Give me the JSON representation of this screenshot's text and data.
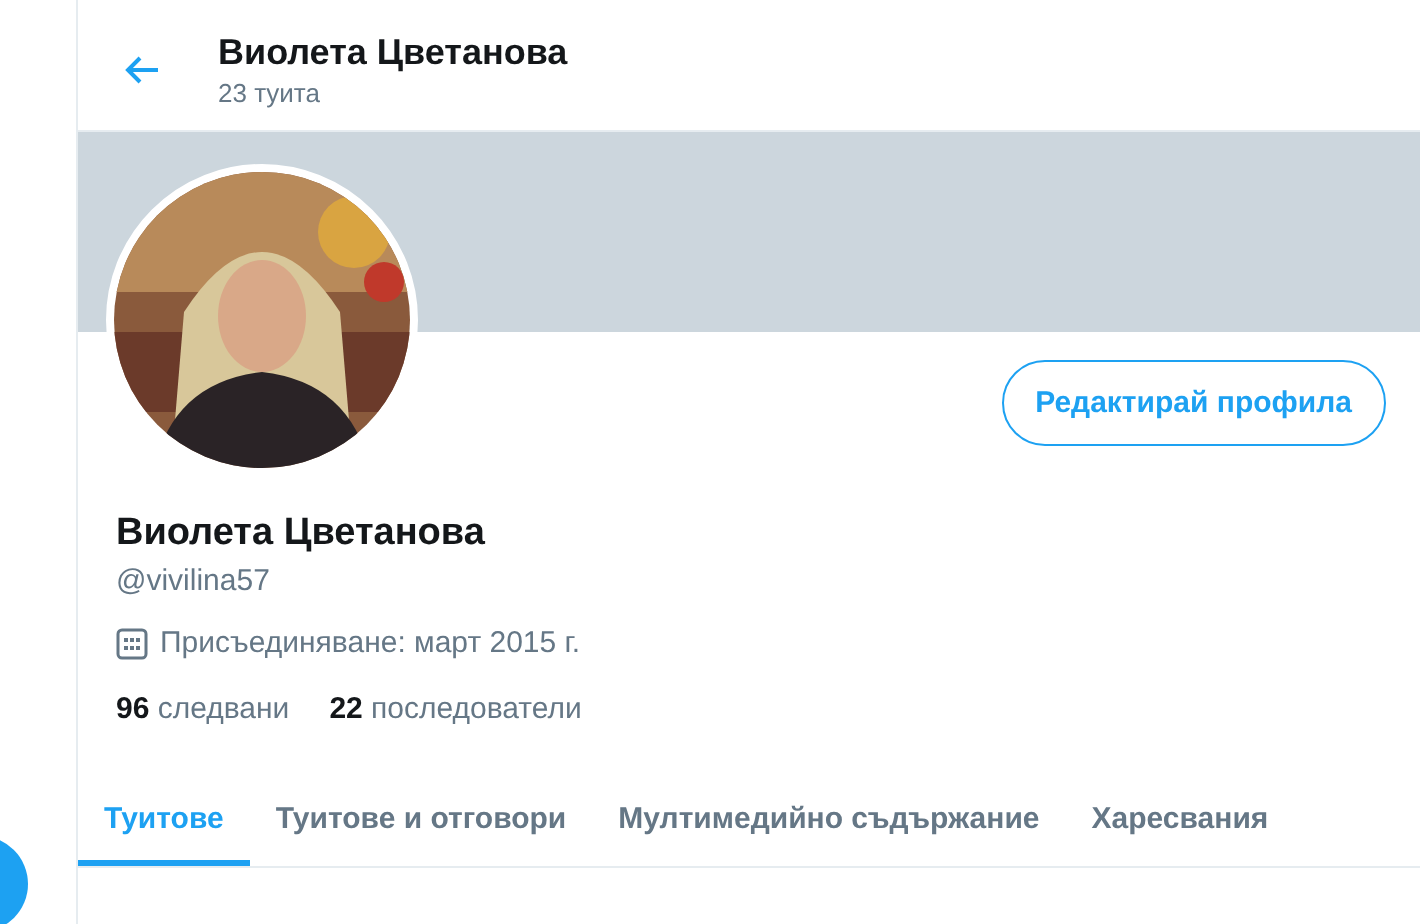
{
  "header": {
    "title": "Виолета Цветанова",
    "subtitle": "23 туита"
  },
  "profile": {
    "edit_button": "Редактирай профила",
    "name": "Виолета Цветанова",
    "handle": "@vivilina57",
    "joined": "Присъединяване: март 2015 г.",
    "stats": [
      "**96** следвани",
      "**22** последователи"
    ]
  },
  "tabs": [
    {
      "label": "Туитове",
      "selected": true
    },
    {
      "label": "Туитове и отговори",
      "selected": false
    },
    {
      "label": "Мултимедийно съдържание",
      "selected": false
    },
    {
      "label": "Харесвания",
      "selected": false
    }
  ]
}
